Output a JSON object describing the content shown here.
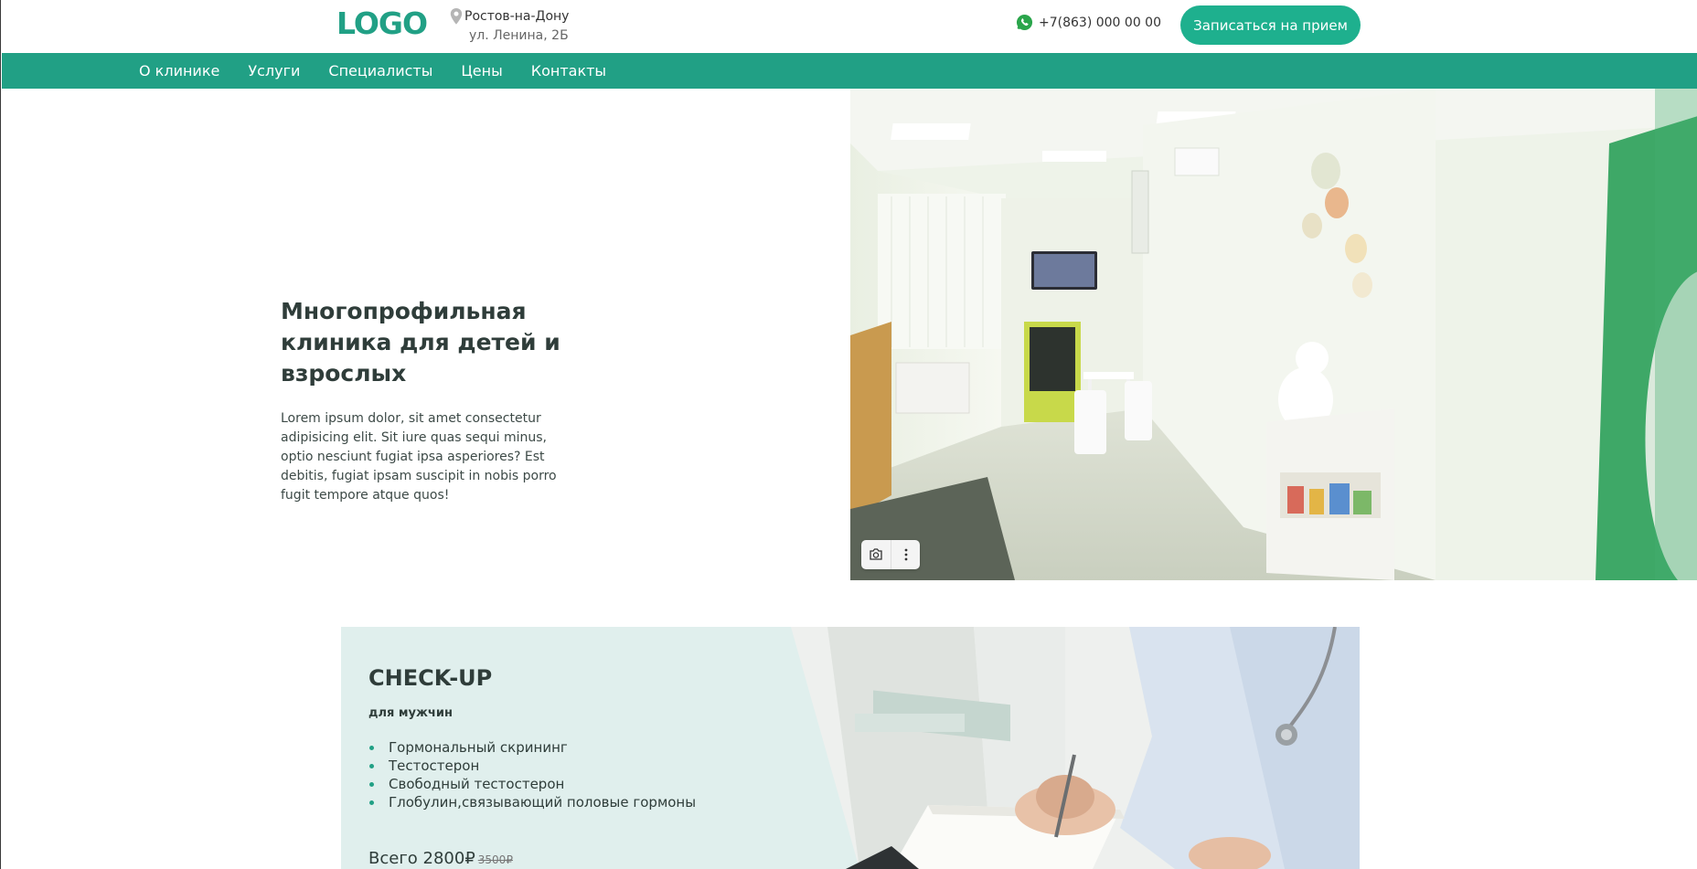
{
  "header": {
    "logo": "LOGO",
    "city": "Ростов-на-Дону",
    "street": "ул. Ленина, 2Б",
    "phone": "+7(863) 000 00 00",
    "cta_label": "Записаться на прием"
  },
  "nav": {
    "items": [
      {
        "label": "О клинике"
      },
      {
        "label": "Услуги"
      },
      {
        "label": "Специалисты"
      },
      {
        "label": "Цены"
      },
      {
        "label": "Контакты"
      }
    ]
  },
  "hero": {
    "title": "Многопрофильная клиника для детей и взрослых",
    "description": "Lorem ipsum dolor, sit amet consectetur adipisicing elit. Sit iure quas sequi minus, optio nesciunt fugiat ipsa asperiores? Est debitis, fugiat ipsam suscipit in nobis porro fugit tempore atque quos!"
  },
  "checkup": {
    "title": "CHECK-UP",
    "subtitle": "для мужчин",
    "items": [
      "Гормональный скрининг",
      "Тестостерон",
      "Свободный тестостерон",
      "Глобулин,связывающий половые гормоны"
    ],
    "price_label": "Всего 2800₽",
    "old_price": "3500₽"
  },
  "colors": {
    "brand": "#21a085",
    "button": "#1eb08e",
    "checkup_bg": "#e0efed"
  }
}
